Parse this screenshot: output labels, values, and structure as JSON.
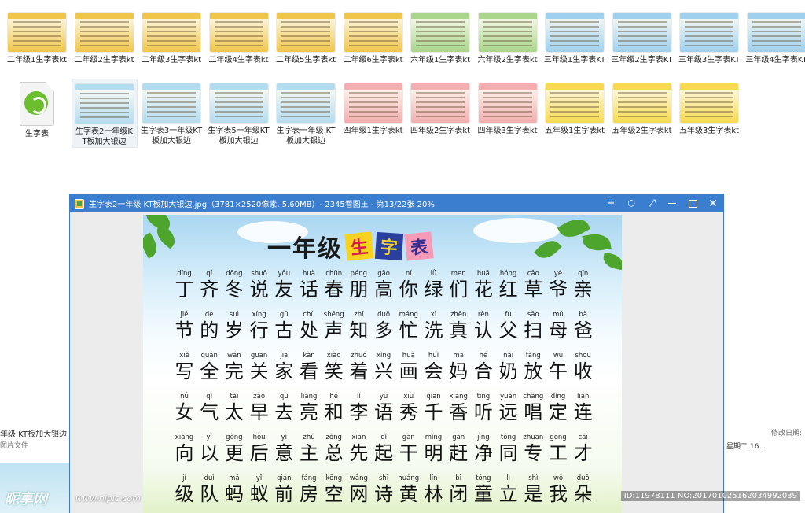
{
  "files_row1": [
    {
      "label": "二年级1生字表kt",
      "color": "#f0c64a"
    },
    {
      "label": "二年级2生字表kt",
      "color": "#f0c64a"
    },
    {
      "label": "二年级3生字表kt",
      "color": "#f0c64a"
    },
    {
      "label": "二年级4生字表kt",
      "color": "#f0c64a"
    },
    {
      "label": "二年级5生字表kt",
      "color": "#f0c64a"
    },
    {
      "label": "二年级6生字表kt",
      "color": "#f0c64a"
    },
    {
      "label": "六年级1生字表kt",
      "color": "#a9d68a"
    },
    {
      "label": "六年级2生字表kt",
      "color": "#a9d68a"
    },
    {
      "label": "三年级1生字表KT",
      "color": "#9fd0ee"
    },
    {
      "label": "三年级2生字表KT",
      "color": "#9fd0ee"
    },
    {
      "label": "三年级3生字表KT",
      "color": "#9fd0ee"
    },
    {
      "label": "三年级4生字表KT",
      "color": "#9fd0ee"
    }
  ],
  "files_row2": [
    {
      "label": "生字表",
      "kind": "doc"
    },
    {
      "label": "生字表2一年级KT板加大银边",
      "color": "#b4dcf0",
      "selected": true
    },
    {
      "label": "生字表3一年级KT板加大银边",
      "color": "#b4dcf0"
    },
    {
      "label": "生字表5一年级KT板加大银边",
      "color": "#b4dcf0"
    },
    {
      "label": "生字表一年级 KT板加大银边",
      "color": "#b4dcf0"
    },
    {
      "label": "四年级1生字表kt",
      "color": "#f2aeb0"
    },
    {
      "label": "四年级2生字表kt",
      "color": "#f2aeb0"
    },
    {
      "label": "四年级3生字表kt",
      "color": "#f2aeb0"
    },
    {
      "label": "五年级1生字表kt",
      "color": "#f6da4f"
    },
    {
      "label": "五年级2生字表kt",
      "color": "#f6da4f"
    },
    {
      "label": "五年级3生字表kt",
      "color": "#f6da4f"
    }
  ],
  "details": {
    "left_name": "年级 KT板加大银边",
    "left_type": "图片文件",
    "right_label": "修改日期:",
    "right_value": "星期二 16..."
  },
  "viewer": {
    "title": "生字表2一年级 KT板加大银边.jpg（3781×2520像素, 5.60MB）- 2345看图王 - 第13/22张 20%",
    "accent": "#3a7ed0"
  },
  "poster": {
    "title_main": "一年级",
    "tag1": "生",
    "tag2": "字",
    "tag3": "表",
    "rows": [
      [
        [
          "dīng",
          "丁"
        ],
        [
          "qí",
          "齐"
        ],
        [
          "dōng",
          "冬"
        ],
        [
          "shuō",
          "说"
        ],
        [
          "yǒu",
          "友"
        ],
        [
          "huà",
          "话"
        ],
        [
          "chūn",
          "春"
        ],
        [
          "péng",
          "朋"
        ],
        [
          "gāo",
          "高"
        ],
        [
          "nǐ",
          "你"
        ],
        [
          "lǜ",
          "绿"
        ],
        [
          "men",
          "们"
        ],
        [
          "huā",
          "花"
        ],
        [
          "hóng",
          "红"
        ],
        [
          "cǎo",
          "草"
        ],
        [
          "yé",
          "爷"
        ],
        [
          "qīn",
          "亲"
        ]
      ],
      [
        [
          "jié",
          "节"
        ],
        [
          "de",
          "的"
        ],
        [
          "suì",
          "岁"
        ],
        [
          "xíng",
          "行"
        ],
        [
          "gǔ",
          "古"
        ],
        [
          "chù",
          "处"
        ],
        [
          "shēng",
          "声"
        ],
        [
          "zhī",
          "知"
        ],
        [
          "duō",
          "多"
        ],
        [
          "máng",
          "忙"
        ],
        [
          "xǐ",
          "洗"
        ],
        [
          "zhēn",
          "真"
        ],
        [
          "rèn",
          "认"
        ],
        [
          "fù",
          "父"
        ],
        [
          "sǎo",
          "扫"
        ],
        [
          "mǔ",
          "母"
        ],
        [
          "bà",
          "爸"
        ]
      ],
      [
        [
          "xiě",
          "写"
        ],
        [
          "quán",
          "全"
        ],
        [
          "wán",
          "完"
        ],
        [
          "guān",
          "关"
        ],
        [
          "jiā",
          "家"
        ],
        [
          "kàn",
          "看"
        ],
        [
          "xiào",
          "笑"
        ],
        [
          "zhuó",
          "着"
        ],
        [
          "xìng",
          "兴"
        ],
        [
          "huà",
          "画"
        ],
        [
          "huì",
          "会"
        ],
        [
          "mā",
          "妈"
        ],
        [
          "hé",
          "合"
        ],
        [
          "nǎi",
          "奶"
        ],
        [
          "fàng",
          "放"
        ],
        [
          "wǔ",
          "午"
        ],
        [
          "shōu",
          "收"
        ]
      ],
      [
        [
          "nǚ",
          "女"
        ],
        [
          "qì",
          "气"
        ],
        [
          "tài",
          "太"
        ],
        [
          "zǎo",
          "早"
        ],
        [
          "qù",
          "去"
        ],
        [
          "liàng",
          "亮"
        ],
        [
          "hé",
          "和"
        ],
        [
          "lǐ",
          "李"
        ],
        [
          "yǔ",
          "语"
        ],
        [
          "xiù",
          "秀"
        ],
        [
          "qiān",
          "千"
        ],
        [
          "xiāng",
          "香"
        ],
        [
          "tīng",
          "听"
        ],
        [
          "yuǎn",
          "远"
        ],
        [
          "chàng",
          "唱"
        ],
        [
          "dìng",
          "定"
        ],
        [
          "lián",
          "连"
        ]
      ],
      [
        [
          "xiàng",
          "向"
        ],
        [
          "yǐ",
          "以"
        ],
        [
          "gèng",
          "更"
        ],
        [
          "hòu",
          "后"
        ],
        [
          "yì",
          "意"
        ],
        [
          "zhǔ",
          "主"
        ],
        [
          "zǒng",
          "总"
        ],
        [
          "xiān",
          "先"
        ],
        [
          "qǐ",
          "起"
        ],
        [
          "gàn",
          "干"
        ],
        [
          "míng",
          "明"
        ],
        [
          "gǎn",
          "赶"
        ],
        [
          "jìng",
          "净"
        ],
        [
          "tóng",
          "同"
        ],
        [
          "zhuān",
          "专"
        ],
        [
          "gōng",
          "工"
        ],
        [
          "cái",
          "才"
        ]
      ],
      [
        [
          "jí",
          "级"
        ],
        [
          "duì",
          "队"
        ],
        [
          "mǎ",
          "蚂"
        ],
        [
          "yǐ",
          "蚁"
        ],
        [
          "qián",
          "前"
        ],
        [
          "fáng",
          "房"
        ],
        [
          "kōng",
          "空"
        ],
        [
          "wǎng",
          "网"
        ],
        [
          "shī",
          "诗"
        ],
        [
          "huáng",
          "黄"
        ],
        [
          "lín",
          "林"
        ],
        [
          "bì",
          "闭"
        ],
        [
          "tóng",
          "童"
        ],
        [
          "lì",
          "立"
        ],
        [
          "shì",
          "是"
        ],
        [
          "wǒ",
          "我"
        ],
        [
          "duǒ",
          "朵"
        ]
      ]
    ]
  },
  "watermarks": {
    "left_logo": "昵享网",
    "left_url": "www.nipic.com",
    "right": "ID:11978111 NO:20170102516203499203​9"
  }
}
